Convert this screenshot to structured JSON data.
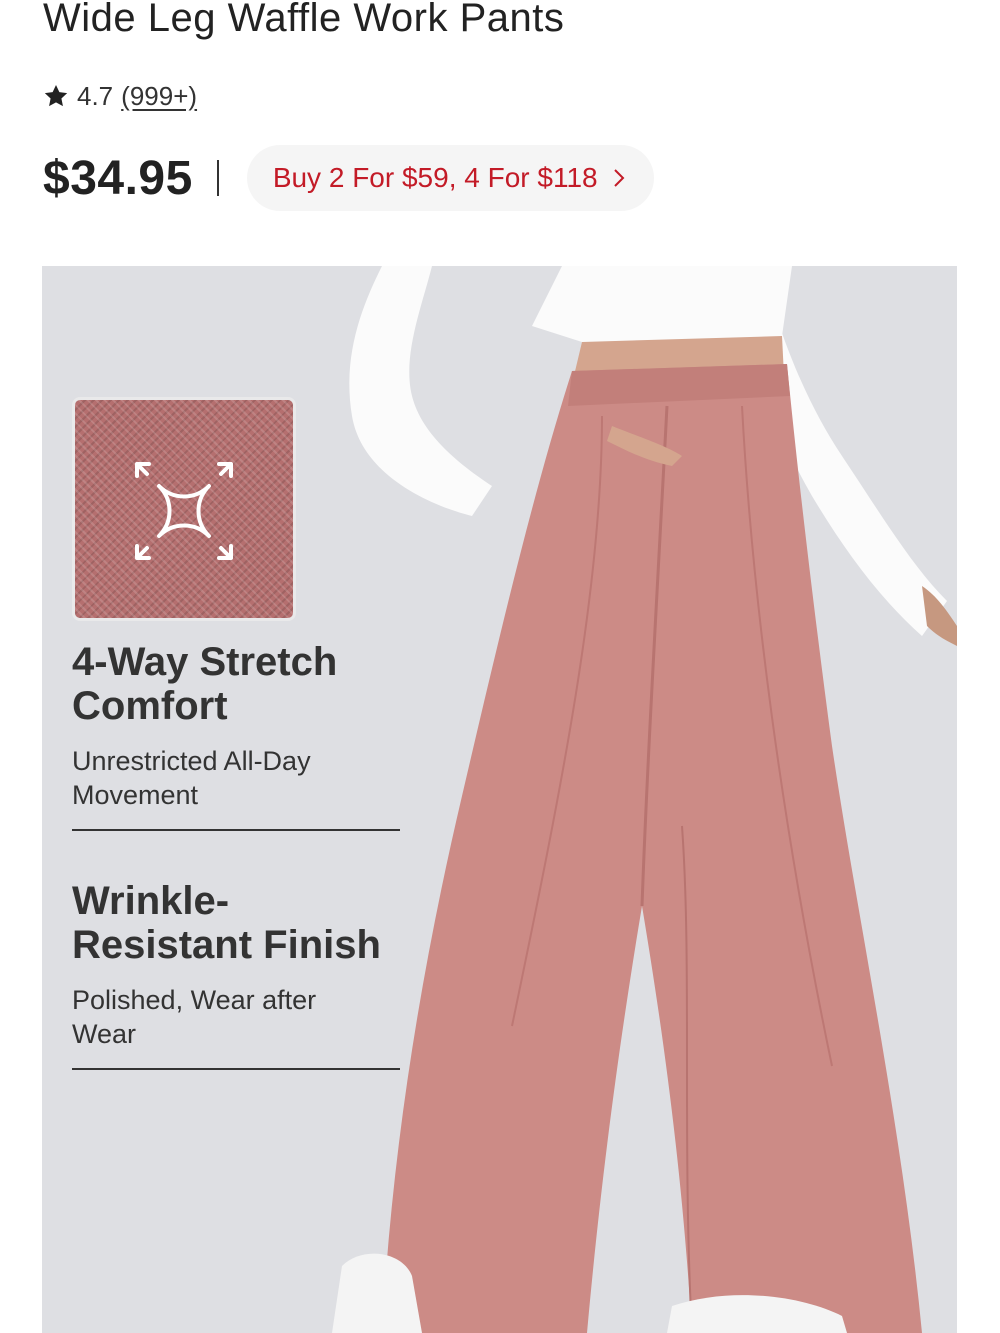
{
  "product": {
    "title": "Wide Leg Waffle Work Pants",
    "rating": "4.7",
    "review_count": "(999+)",
    "price": "$34.95",
    "separator": "|",
    "promo_label": "Buy 2 For $59, 4 For $118"
  },
  "hero": {
    "features": [
      {
        "title_line1": "4-Way Stretch",
        "title_line2": "Comfort",
        "subtitle_line1": "Unrestricted All-Day",
        "subtitle_line2": "Movement"
      },
      {
        "title_line1": "Wrinkle-",
        "title_line2": "Resistant Finish",
        "subtitle_line1": "Polished, Wear after",
        "subtitle_line2": "Wear"
      }
    ]
  },
  "colors": {
    "promo_text": "#c31b27",
    "promo_bg": "#f5f5f5",
    "hero_bg": "#dedfe3",
    "pants": "#cc8b86"
  },
  "icons": [
    "star-icon",
    "chevron-right-icon",
    "stretch-icon"
  ]
}
